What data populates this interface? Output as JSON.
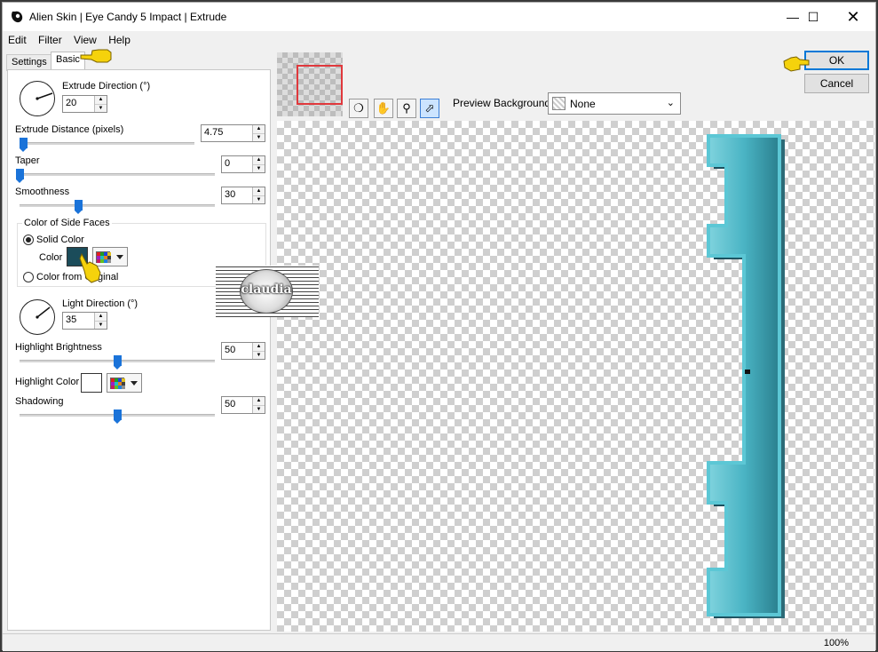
{
  "window": {
    "title": "Alien Skin | Eye Candy 5 Impact | Extrude"
  },
  "menu": [
    "Edit",
    "Filter",
    "View",
    "Help"
  ],
  "tabs": {
    "settings": "Settings",
    "basic": "Basic"
  },
  "basic": {
    "extrude_direction": {
      "label": "Extrude Direction (°)",
      "value": "20"
    },
    "extrude_distance": {
      "label": "Extrude Distance (pixels)",
      "value": "4.75",
      "slider_fraction": 0.02
    },
    "taper": {
      "label": "Taper",
      "value": "0",
      "slider_fraction": 0.0
    },
    "smoothness": {
      "label": "Smoothness",
      "value": "30",
      "slider_fraction": 0.3
    },
    "side_faces": {
      "group_label": "Color of Side Faces",
      "solid_color_label": "Solid Color",
      "color_label": "Color",
      "color_value": "#1b4c5a",
      "from_original_label": "Color from Original"
    },
    "light_direction": {
      "label": "Light Direction (°)",
      "value": "35"
    },
    "highlight_brightness": {
      "label": "Highlight Brightness",
      "value": "50",
      "slider_fraction": 0.5
    },
    "highlight_color": {
      "label": "Highlight Color",
      "value": "#ffffff"
    },
    "shadowing": {
      "label": "Shadowing",
      "value": "50",
      "slider_fraction": 0.5
    }
  },
  "preview": {
    "background_label": "Preview Background:",
    "background_value": "None",
    "object_color": "#3aa7b8",
    "zoom": "100%"
  },
  "buttons": {
    "ok": "OK",
    "cancel": "Cancel"
  },
  "watermark_text": "claudia",
  "colors": {
    "accent": "#0078d7",
    "slider": "#1a73d9",
    "hand_pointer": "#f5d20c"
  },
  "icons": [
    "eye-candy-logo-icon",
    "minimize-icon",
    "maximize-icon",
    "close-icon",
    "color-picker-icon",
    "hand-tool-icon",
    "zoom-tool-icon",
    "pointer-tool-icon",
    "pointing-hand-icon"
  ]
}
